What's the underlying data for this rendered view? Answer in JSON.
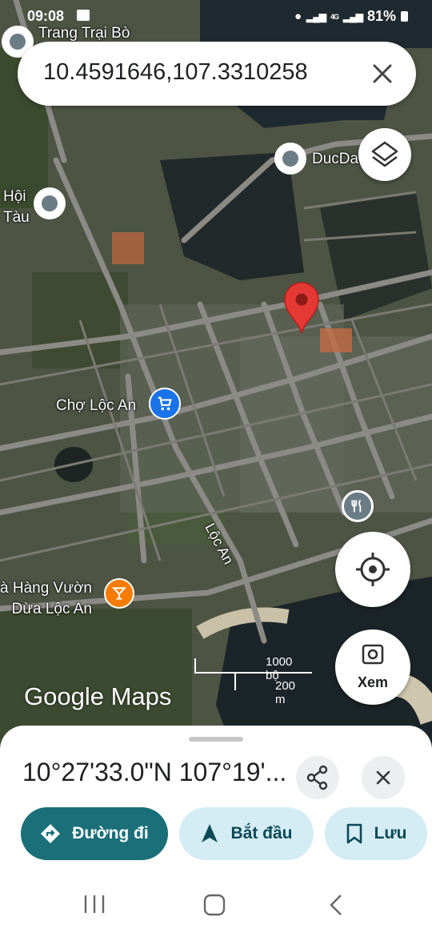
{
  "status_bar": {
    "time": "09:08",
    "network": "4G",
    "battery": "81%"
  },
  "search": {
    "query": "10.4591646,107.3310258"
  },
  "map": {
    "places": [
      {
        "id": "trang-trai-bo",
        "name": "Trang Trại Bò"
      },
      {
        "id": "ducda",
        "name": "DucDa"
      },
      {
        "id": "hoi-tau",
        "name": "Hội\nTàu"
      },
      {
        "id": "cho-loc-an",
        "name": "Chợ Lộc An"
      },
      {
        "id": "nha-hang",
        "name": "à Hàng Vườn\nDừa Lộc An"
      }
    ],
    "road_label": "Lộc An",
    "scale": {
      "imperial": "1000 bộ",
      "metric": "200 m"
    },
    "logo": "Google Maps",
    "view_button_label": "Xem"
  },
  "sheet": {
    "coordinates": "10°27'33.0\"N 107°19'...",
    "actions": [
      {
        "id": "directions",
        "label": "Đường đi",
        "icon": "directions-icon"
      },
      {
        "id": "start",
        "label": "Bắt đầu",
        "icon": "navigation-arrow-icon"
      },
      {
        "id": "save",
        "label": "Lưu",
        "icon": "bookmark-icon"
      }
    ]
  },
  "colors": {
    "accent": "#1a6f79",
    "secondary_button": "#d4ecf4",
    "pin": "#e53935",
    "market": "#1a73e8",
    "restaurant": "#f57c00"
  }
}
